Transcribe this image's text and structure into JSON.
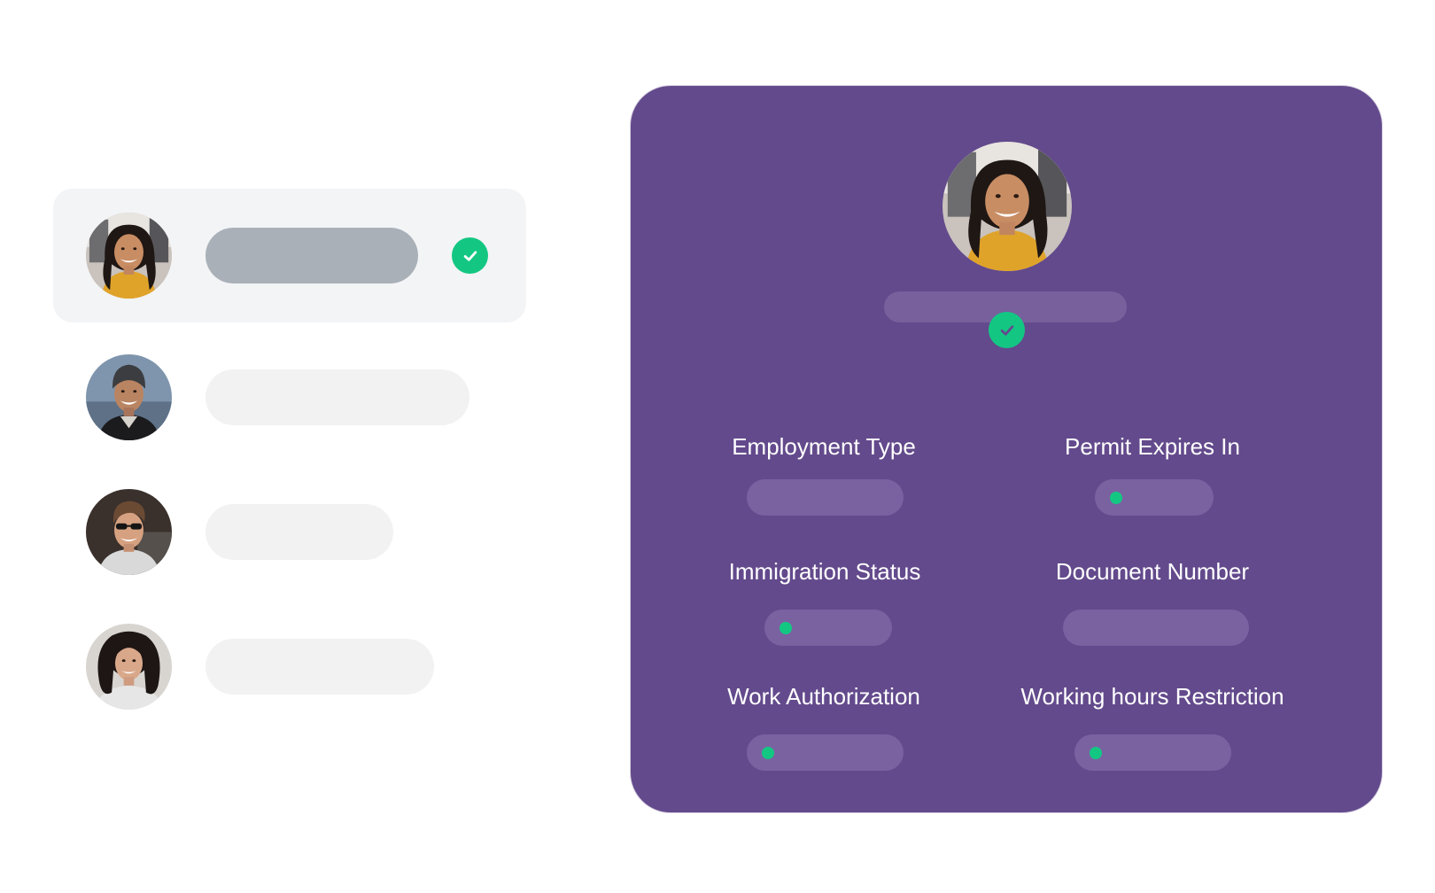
{
  "employee_list": {
    "items": [
      {
        "avatar": "avatar-woman-smiling",
        "selected": true,
        "verified": true
      },
      {
        "avatar": "avatar-man-beanie",
        "selected": false,
        "verified": false
      },
      {
        "avatar": "avatar-man-sunglasses",
        "selected": false,
        "verified": false
      },
      {
        "avatar": "avatar-woman-curly-hair",
        "selected": false,
        "verified": false
      }
    ]
  },
  "profile": {
    "avatar": "avatar-woman-smiling",
    "verified": true,
    "fields": [
      {
        "label": "Employment Type",
        "status_dot": false
      },
      {
        "label": "Permit Expires In",
        "status_dot": true
      },
      {
        "label": "Immigration Status",
        "status_dot": true
      },
      {
        "label": "Document Number",
        "status_dot": false
      },
      {
        "label": "Work Authorization",
        "status_dot": true
      },
      {
        "label": "Working hours Restriction",
        "status_dot": true
      }
    ]
  },
  "colors": {
    "card_background": "#634a8c",
    "accent_green": "#13c783",
    "selected_row": "#f3f4f6",
    "placeholder_pill": "#f2f2f2",
    "selected_pill": "#a9b0b8"
  },
  "icons": [
    "check-icon",
    "status-dot-icon"
  ]
}
